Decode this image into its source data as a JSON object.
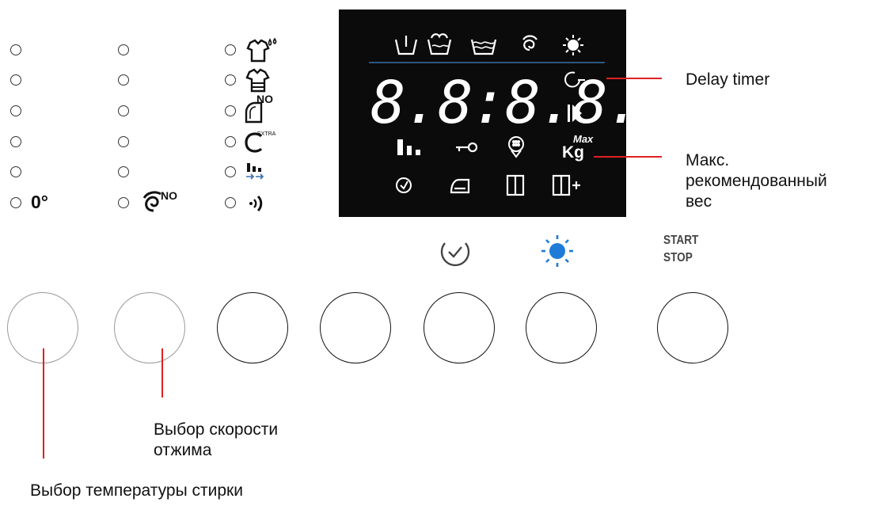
{
  "display": {
    "digits": "8.8:8.8.",
    "kg_label": "Kg",
    "max_label": "Max"
  },
  "left_panel": {
    "temp_zero_label": "0°",
    "spin_no_label": "NO",
    "iron_no_label": "NO",
    "extra_label": "EXTRA"
  },
  "start_stop": {
    "line1": "START",
    "line2": "STOP"
  },
  "annotations": {
    "delay_timer": "Delay timer",
    "max_weight_line1": "Макс.",
    "max_weight_line2": "рекомендованный",
    "max_weight_line3": "вес",
    "spin_line1": "Выбор скорости",
    "spin_line2": "отжима",
    "temperature": "Выбор температуры стирки"
  },
  "colors": {
    "accent_blue": "#1e7bd8",
    "leader_red": "#e02020",
    "display_bg": "#0b0b0b",
    "display_line": "#3a6fa8"
  }
}
